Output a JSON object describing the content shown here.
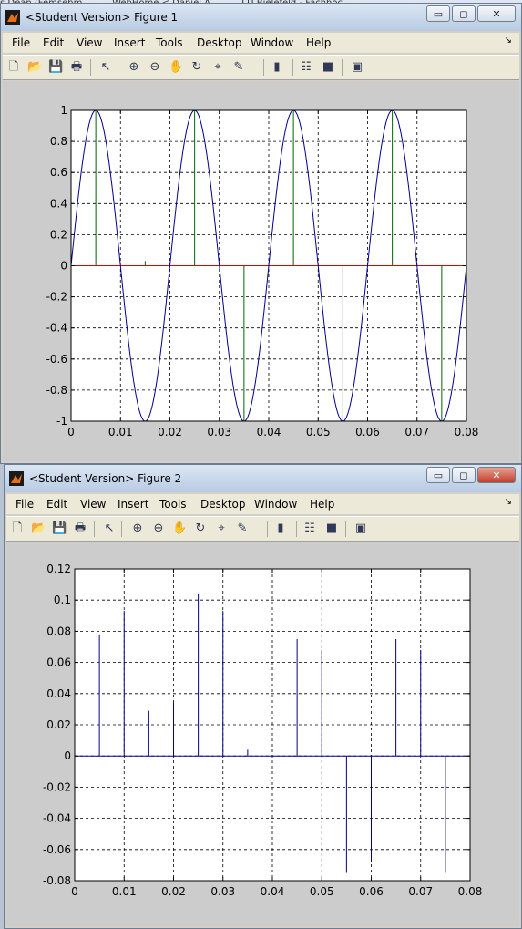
{
  "taskbar": {
    "items": [
      "s Dean (Femsehm...",
      "WebHome < Daniel A...",
      "TTI Bielefeld - Fachhoc..."
    ]
  },
  "windows": [
    {
      "title": "<Student Version> Figure 1",
      "menu": [
        "File",
        "Edit",
        "View",
        "Insert",
        "Tools",
        "Desktop",
        "Window",
        "Help"
      ],
      "controls": {
        "minimize": "▭",
        "maximize": "◻",
        "close": "✕"
      }
    },
    {
      "title": "<Student Version> Figure 2",
      "menu": [
        "File",
        "Edit",
        "View",
        "Insert",
        "Tools",
        "Desktop",
        "Window",
        "Help"
      ],
      "controls": {
        "minimize": "▭",
        "maximize": "◻",
        "close": "✕"
      }
    }
  ],
  "toolbar_icons": [
    "new-figure-icon",
    "open-file-icon",
    "save-icon",
    "print-icon",
    "pointer-icon",
    "zoom-in-icon",
    "zoom-out-icon",
    "pan-hand-icon",
    "rotate-3d-icon",
    "data-cursor-icon",
    "brush-icon",
    "colorbar-icon",
    "legend-icon",
    "hide-plot-tools-icon",
    "show-plot-tools-icon"
  ],
  "colors": {
    "sine": "#00008b",
    "samples": "#006400",
    "zeroline": "#e00000",
    "stems2": "#00008b",
    "grid": "#000000"
  },
  "chart_data": [
    {
      "type": "line",
      "title": "",
      "xlabel": "",
      "ylabel": "",
      "xlim": [
        0,
        0.08
      ],
      "ylim": [
        -1,
        1
      ],
      "xticks": [
        "0",
        "0.01",
        "0.02",
        "0.03",
        "0.04",
        "0.05",
        "0.06",
        "0.07",
        "0.08"
      ],
      "yticks": [
        "1",
        "0.8",
        "0.6",
        "0.4",
        "0.2",
        "0",
        "-0.2",
        "-0.4",
        "-0.6",
        "-0.8",
        "-1"
      ],
      "grid": true,
      "series": [
        {
          "kind": "line",
          "function": "sin(2*pi*50*t)",
          "frequency_hz": 50,
          "x_range": [
            0,
            0.08
          ]
        },
        {
          "kind": "stem",
          "x": [
            0.005,
            0.015,
            0.025,
            0.035,
            0.045,
            0.055,
            0.065,
            0.075
          ],
          "values": [
            1,
            0.03,
            1,
            -1,
            1,
            -1,
            1,
            -1
          ]
        },
        {
          "kind": "line",
          "x": [
            0,
            0.08
          ],
          "values": [
            0,
            0
          ]
        }
      ]
    },
    {
      "type": "bar",
      "title": "",
      "xlabel": "",
      "ylabel": "",
      "xlim": [
        0,
        0.08
      ],
      "ylim": [
        -0.08,
        0.12
      ],
      "xticks": [
        "0",
        "0.01",
        "0.02",
        "0.03",
        "0.04",
        "0.05",
        "0.06",
        "0.07",
        "0.08"
      ],
      "yticks": [
        "0.12",
        "0.1",
        "0.08",
        "0.06",
        "0.04",
        "0.02",
        "0",
        "-0.02",
        "-0.04",
        "-0.06",
        "-0.08"
      ],
      "grid": true,
      "series": [
        {
          "kind": "stem",
          "x": [
            0.005,
            0.01,
            0.015,
            0.02,
            0.025,
            0.03,
            0.035,
            0.045,
            0.05,
            0.055,
            0.06,
            0.065,
            0.07,
            0.075
          ],
          "values": [
            0.078,
            0.093,
            0.029,
            0.034,
            0.104,
            0.093,
            0.004,
            0.075,
            0.068,
            -0.075,
            -0.068,
            0.075,
            0.068,
            -0.075
          ]
        }
      ]
    }
  ]
}
